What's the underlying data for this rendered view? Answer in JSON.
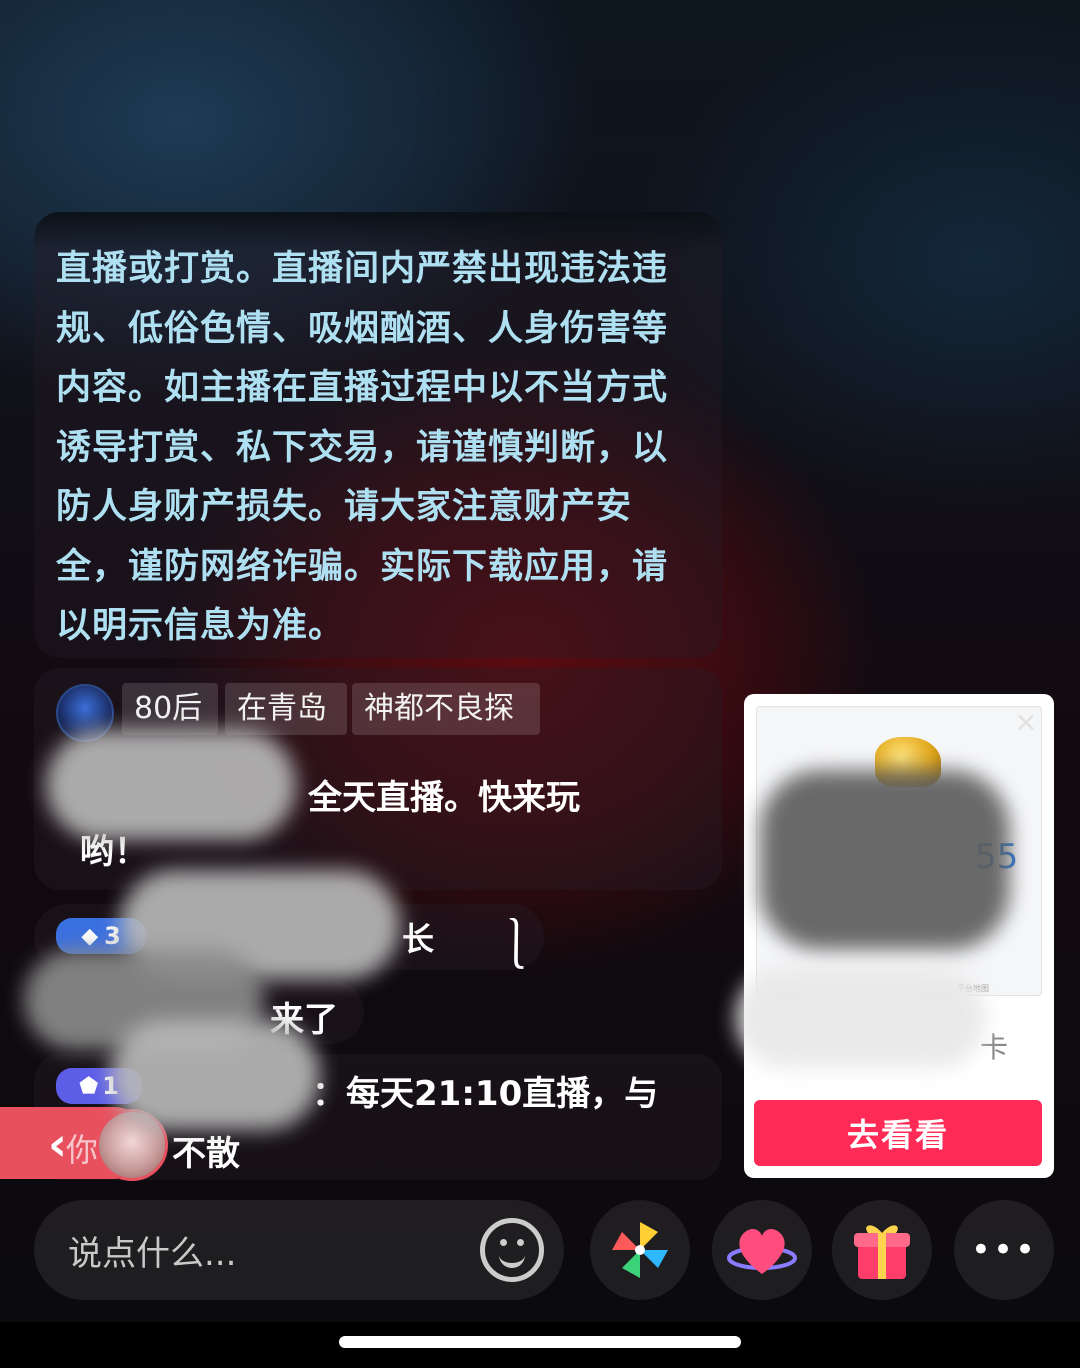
{
  "notice": {
    "text": "直播或打赏。直播间内严禁出现违法违规、低俗色情、吸烟酗酒、人身伤害等内容。如主播在直播过程中以不当方式诱导打赏、私下交易，请谨慎判断，以防人身财产损失。请大家注意财产安全，谨防网络诈骗。实际下载应用，请以明示信息为准。"
  },
  "streamer_intro": {
    "tags": [
      "80后",
      "在青岛",
      "神都不良探"
    ],
    "message_line1": "全天直播。快来玩",
    "message_line2": "哟！"
  },
  "chat": [
    {
      "badge": "3",
      "text": "长",
      "extra": "⎱"
    },
    {
      "text": "来了"
    },
    {
      "badge": "1",
      "text": "：每天21:10直播，与",
      "text2": "不散"
    }
  ],
  "back_tab": {
    "arrow": "‹",
    "label": "你"
  },
  "product_card": {
    "price_fragment": "55",
    "sub_fragment": "卡",
    "tiny_caption": "平台地图",
    "button_label": "去看看"
  },
  "bottom_bar": {
    "input_placeholder": "说点什么...",
    "more_label": "•••"
  },
  "colors": {
    "notice_text": "#aee0f2",
    "accent": "#ff2a55",
    "back_tab": "#e8505e"
  }
}
